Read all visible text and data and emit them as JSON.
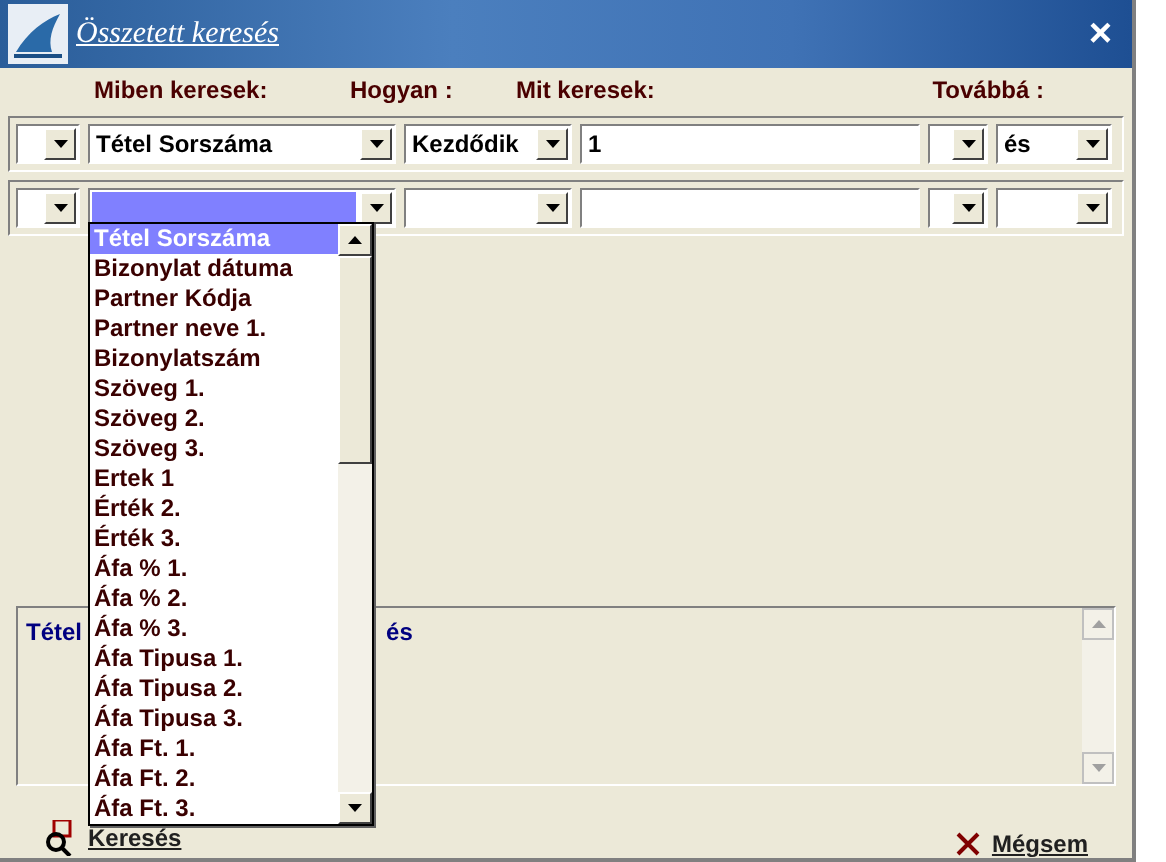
{
  "window": {
    "title": "Összetett keresés",
    "close": "×"
  },
  "headers": [
    "Miben keresek:",
    "Hogyan :",
    "Mit keresek:",
    "Továbbá :"
  ],
  "rows": [
    {
      "prefix": "",
      "field": "Tétel Sorszáma",
      "field_focused": false,
      "method": "Kezdődik",
      "value": "1",
      "suffix": "",
      "next": "és"
    },
    {
      "prefix": "",
      "field": "",
      "field_focused": true,
      "method": "",
      "value": "",
      "suffix": "",
      "next": ""
    }
  ],
  "dropdown": {
    "items": [
      {
        "label": "Tétel Sorszáma",
        "selected": true
      },
      {
        "label": "Bizonylat dátuma",
        "selected": false
      },
      {
        "label": "Partner Kódja",
        "selected": false
      },
      {
        "label": "Partner neve 1.",
        "selected": false
      },
      {
        "label": "Bizonylatszám",
        "selected": false
      },
      {
        "label": "Szöveg 1.",
        "selected": false
      },
      {
        "label": "Szöveg 2.",
        "selected": false
      },
      {
        "label": "Szöveg 3.",
        "selected": false
      },
      {
        "label": "Ertek 1",
        "selected": false
      },
      {
        "label": "Érték 2.",
        "selected": false
      },
      {
        "label": "Érték 3.",
        "selected": false
      },
      {
        "label": "Áfa % 1.",
        "selected": false
      },
      {
        "label": "Áfa % 2.",
        "selected": false
      },
      {
        "label": "Áfa % 3.",
        "selected": false
      },
      {
        "label": "Áfa Tipusa 1.",
        "selected": false
      },
      {
        "label": "Áfa Tipusa 2.",
        "selected": false
      },
      {
        "label": "Áfa Tipusa 3.",
        "selected": false
      },
      {
        "label": "Áfa Ft. 1.",
        "selected": false
      },
      {
        "label": "Áfa Ft. 2.",
        "selected": false
      },
      {
        "label": "Áfa Ft. 3.",
        "selected": false
      }
    ]
  },
  "summary": {
    "text_left": "Tétel",
    "text_right": "és"
  },
  "buttons": [
    {
      "kind": "search",
      "label": "Keresés"
    },
    {
      "kind": "cancel",
      "label": "Mégsem"
    }
  ]
}
